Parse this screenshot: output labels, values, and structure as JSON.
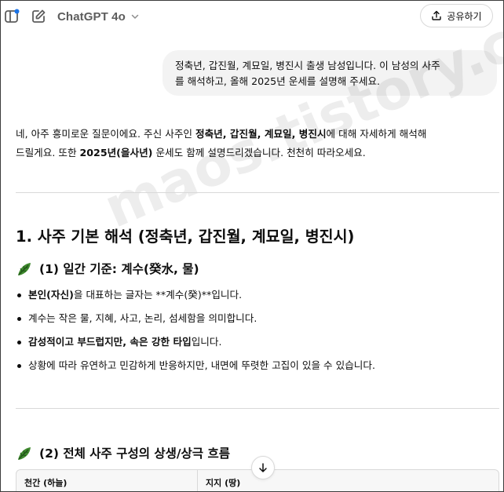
{
  "header": {
    "model_name": "ChatGPT 4o",
    "share_label": "공유하기",
    "icons": {
      "sidebar": "sidebar-toggle-icon",
      "edit": "new-chat-icon",
      "dropdown": "chevron-down-icon",
      "share": "share-upload-icon"
    },
    "notification_dot_color": "#1a73e8"
  },
  "user_message": {
    "line1": "정축년, 갑진월, 계묘일, 병진시 출생 남성입니다. 이 남성의 사주",
    "line2": "를 해석하고, 올해 2025년 운세를 설명해 주세요."
  },
  "assistant": {
    "intro": {
      "p1_a": "네, 아주 흥미로운 질문이에요. 주신 사주인 ",
      "p1_b": "정축년, 갑진월, 계묘일, 병진시",
      "p1_c": "에 대해 자세하게 해석해",
      "p2_a": "드릴게요. 또한 ",
      "p2_b": "2025년(을사년)",
      "p2_c": " 운세도 함께 설명드리겠습니다. 천천히 따라오세요."
    },
    "section1_title": "1. 사주 기본 해석 (정축년, 갑진월, 계묘일, 병진시)",
    "sub1_title": "(1) 일간 기준: 계수(癸水, 물)",
    "bullets": [
      {
        "bold": "본인(자신)",
        "text": "을 대표하는 글자는 **계수(癸)**입니다."
      },
      {
        "bold": "",
        "text": "계수는 작은 물, 지혜, 사고, 논리, 섬세함을 의미합니다."
      },
      {
        "bold": "감성적이고 부드럽지만, 속은 강한 타입",
        "text": "입니다."
      },
      {
        "bold": "",
        "text": "상황에 따라 유연하고 민감하게 반응하지만, 내면에 뚜렷한 고집이 있을 수 있습니다."
      }
    ],
    "sub2_title": "(2) 전체 사주 구성의 상생/상극 흐름",
    "table_headers": [
      "천간 (하늘)",
      "지지 (땅)"
    ],
    "leaf_icon": "herb-leaf-icon",
    "scroll_icon": "arrow-down-icon"
  },
  "watermark": "maos.tistory.com"
}
